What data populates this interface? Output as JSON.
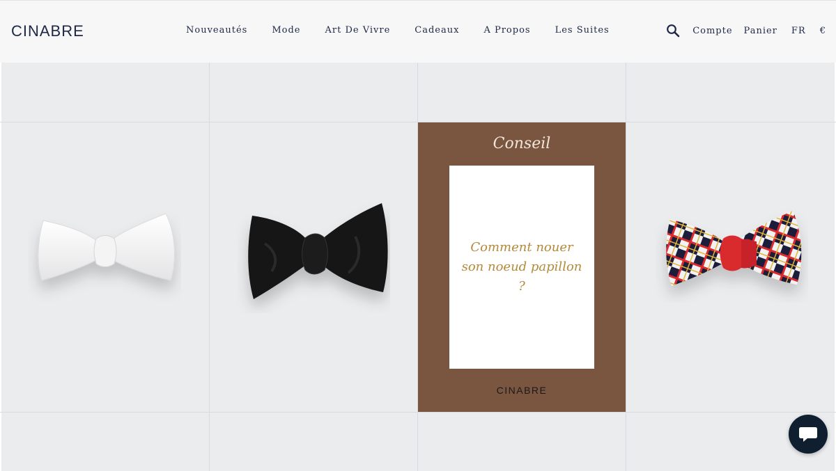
{
  "brand": {
    "logo": "CINABRE"
  },
  "nav": {
    "items": [
      {
        "label": "Nouveautés"
      },
      {
        "label": "Mode"
      },
      {
        "label": "Art De Vivre"
      },
      {
        "label": "Cadeaux"
      },
      {
        "label": "A Propos"
      },
      {
        "label": "Les Suites"
      }
    ]
  },
  "utility": {
    "search_icon": "search-icon",
    "account": "Compte",
    "cart": "Panier",
    "language": "FR",
    "currency": "€"
  },
  "products": [
    {
      "name": "white-satin-bow-tie",
      "colors": [
        "#ffffff",
        "#e8e8ea"
      ]
    },
    {
      "name": "black-silk-bow-tie",
      "colors": [
        "#111111",
        "#2a2a2a"
      ]
    },
    {
      "name": "tartan-bow-tie",
      "colors": [
        "#1b1f3a",
        "#d92b2f",
        "#f2f2f2",
        "#e0b43a"
      ]
    }
  ],
  "conseil": {
    "heading": "Conseil",
    "text": "Comment nouer son noeud papillon ?",
    "brand": "CINABRE"
  },
  "colors": {
    "background_tile": "#ebecee",
    "header_bg": "#f7f7f8",
    "navy": "#1e2845",
    "card_brown": "#7a5641",
    "gold_text": "#b48a3a",
    "chat_bg": "#0f1f30"
  },
  "chat": {
    "icon": "chat-bubble-icon"
  }
}
